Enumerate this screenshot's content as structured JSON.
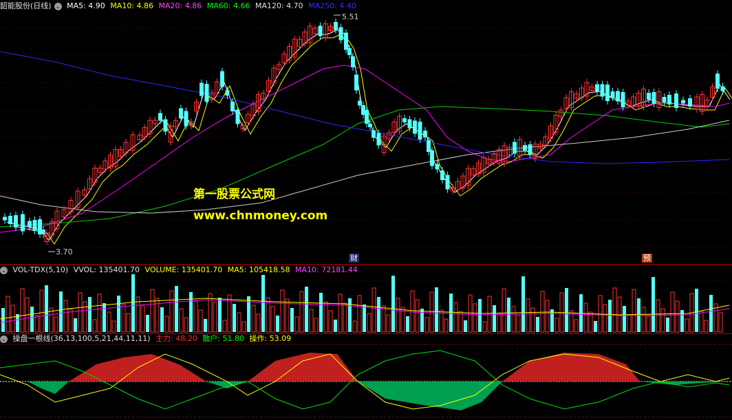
{
  "main": {
    "title": "韶能股份(日线)",
    "ma": [
      {
        "label": "MA5: 4.90",
        "color": "#ffffff"
      },
      {
        "label": "MA10: 4.86",
        "color": "#ffff00"
      },
      {
        "label": "MA20: 4.86",
        "color": "#ff00ff"
      },
      {
        "label": "MA60: 4.66",
        "color": "#00ff00"
      },
      {
        "label": "MA120: 4.70",
        "color": "#e0e0e0"
      },
      {
        "label": "MA250: 4.40",
        "color": "#2a2aff"
      }
    ],
    "high_label": "5.51",
    "low_label": "3.70",
    "watermark_cn": "第一股票公式网",
    "watermark_url": "www.chnmoney.com",
    "marker_cai": "财",
    "marker_yu": "预"
  },
  "volume": {
    "title": "VOL-TDX(5,10)",
    "vvol": "VVOL: 135401.70",
    "volume": "VOLUME: 135401.70",
    "ma5": "MA5: 105418.58",
    "ma10": "MA10: 72181.44"
  },
  "indicator": {
    "title": "操盘一根线(36,13,100,5,21,44,11,11)",
    "zhuli": "主力: 48.20",
    "sanhu": "散户: 51.80",
    "caozuo": "操作: 53.09"
  },
  "colors": {
    "up": "#ff3232",
    "down": "#54ffff",
    "sep": "#b00000"
  }
}
